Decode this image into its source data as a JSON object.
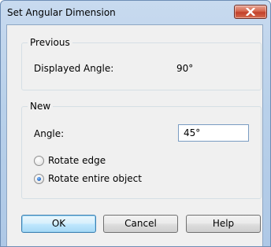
{
  "window": {
    "title": "Set Angular Dimension",
    "close_icon": "close-icon"
  },
  "previous": {
    "legend": "Previous",
    "displayed_angle_label": "Displayed Angle:",
    "displayed_angle_value": "90°"
  },
  "new": {
    "legend": "New",
    "angle_label": "Angle:",
    "angle_value": "45°",
    "options": [
      {
        "label": "Rotate edge",
        "checked": false
      },
      {
        "label": "Rotate entire object",
        "checked": true
      }
    ]
  },
  "buttons": {
    "ok": "OK",
    "cancel": "Cancel",
    "help": "Help"
  },
  "colors": {
    "title_bar": "#b9d1ea",
    "close_button": "#c2412a",
    "dialog_face": "#f0f0f0",
    "default_button": "#bee6fd"
  }
}
